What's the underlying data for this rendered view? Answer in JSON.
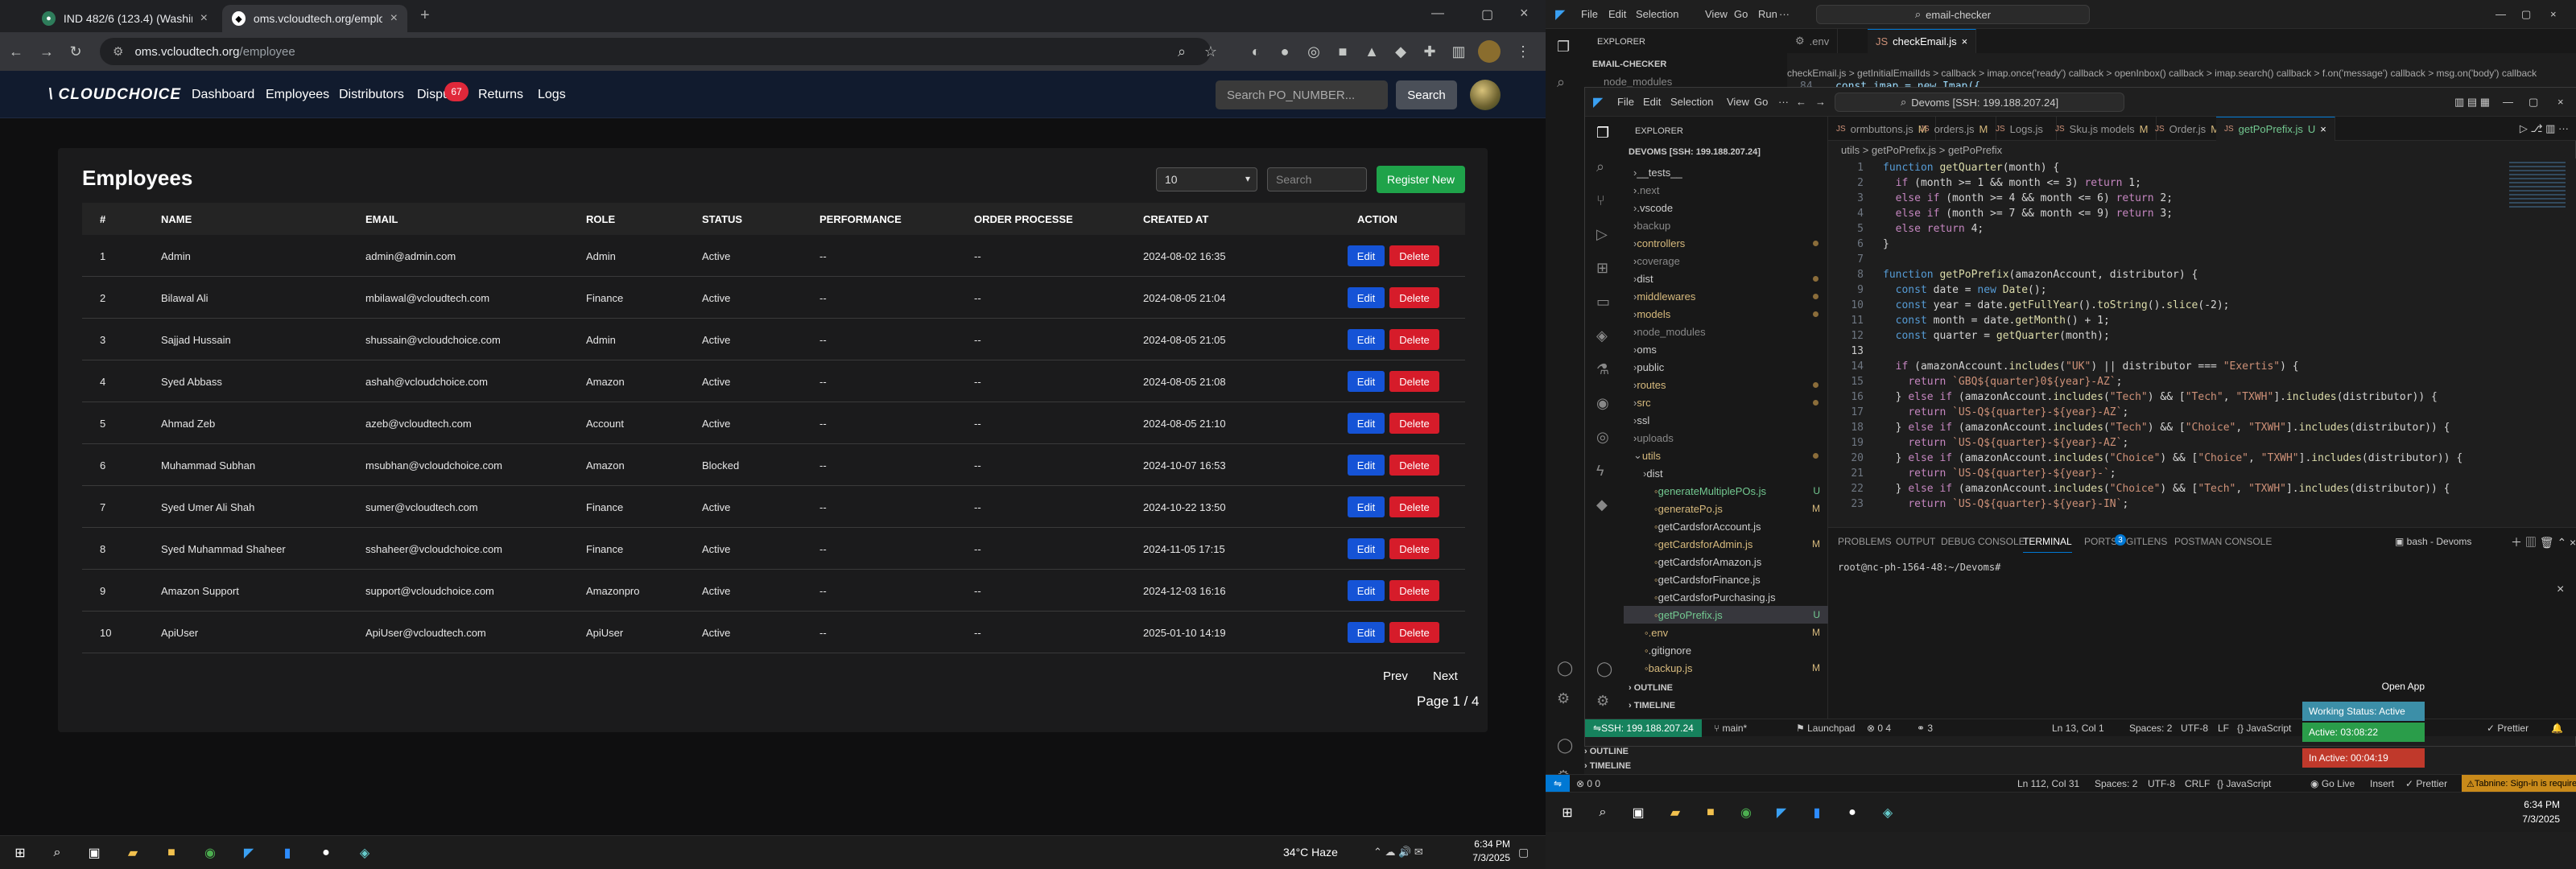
{
  "left_browser": {
    "tabs": [
      {
        "title": "IND 482/6 (123.4) (Washingto",
        "active": false
      },
      {
        "title": "oms.vcloudtech.org/employee",
        "active": true
      }
    ],
    "url_host": "oms.vcloudtech.org",
    "url_path": "/employee"
  },
  "app": {
    "logo": "\\ CLOUDCHOICE",
    "nav": [
      "Dashboard",
      "Employees",
      "Distributors",
      "Dispu",
      "Returns",
      "Logs"
    ],
    "dispute_badge": "67",
    "search_placeholder": "Search PO_NUMBER...",
    "search_button": "Search"
  },
  "employees": {
    "title": "Employees",
    "per_page": "10",
    "search_placeholder": "Search",
    "register_button": "Register New",
    "columns": [
      "#",
      "NAME",
      "EMAIL",
      "ROLE",
      "STATUS",
      "PERFORMANCE",
      "ORDER PROCESSE",
      "CREATED AT",
      "ACTION"
    ],
    "rows": [
      {
        "n": "1",
        "name": "Admin",
        "email": "admin@admin.com",
        "role": "Admin",
        "status": "Active",
        "perf": "--",
        "order": "--",
        "created": "2024-08-02 16:35"
      },
      {
        "n": "2",
        "name": "Bilawal Ali",
        "email": "mbilawal@vcloudtech.com",
        "role": "Finance",
        "status": "Active",
        "perf": "--",
        "order": "--",
        "created": "2024-08-05 21:04"
      },
      {
        "n": "3",
        "name": "Sajjad Hussain",
        "email": "shussain@vcloudchoice.com",
        "role": "Admin",
        "status": "Active",
        "perf": "--",
        "order": "--",
        "created": "2024-08-05 21:05"
      },
      {
        "n": "4",
        "name": "Syed Abbass",
        "email": "ashah@vcloudchoice.com",
        "role": "Amazon",
        "status": "Active",
        "perf": "--",
        "order": "--",
        "created": "2024-08-05 21:08"
      },
      {
        "n": "5",
        "name": "Ahmad Zeb",
        "email": "azeb@vcloudtech.com",
        "role": "Account",
        "status": "Active",
        "perf": "--",
        "order": "--",
        "created": "2024-08-05 21:10"
      },
      {
        "n": "6",
        "name": "Muhammad Subhan",
        "email": "msubhan@vcloudchoice.com",
        "role": "Amazon",
        "status": "Blocked",
        "perf": "--",
        "order": "--",
        "created": "2024-10-07 16:53"
      },
      {
        "n": "7",
        "name": "Syed Umer Ali Shah",
        "email": "sumer@vcloudtech.com",
        "role": "Finance",
        "status": "Active",
        "perf": "--",
        "order": "--",
        "created": "2024-10-22 13:50"
      },
      {
        "n": "8",
        "name": "Syed Muhammad Shaheer",
        "email": "sshaheer@vcloudchoice.com",
        "role": "Finance",
        "status": "Active",
        "perf": "--",
        "order": "--",
        "created": "2024-11-05 17:15"
      },
      {
        "n": "9",
        "name": "Amazon Support",
        "email": "support@vcloudchoice.com",
        "role": "Amazonpro",
        "status": "Active",
        "perf": "--",
        "order": "--",
        "created": "2024-12-03 16:16"
      },
      {
        "n": "10",
        "name": "ApiUser",
        "email": "ApiUser@vcloudtech.com",
        "role": "ApiUser",
        "status": "Active",
        "perf": "--",
        "order": "--",
        "created": "2025-01-10 14:19"
      }
    ],
    "edit_label": "Edit",
    "delete_label": "Delete",
    "prev": "Prev",
    "next": "Next",
    "page_info": "Page 1 / 4"
  },
  "left_taskbar": {
    "weather": "34°C  Haze",
    "time": "6:34 PM",
    "date": "7/3/2025"
  },
  "vscode1": {
    "menus": [
      "File",
      "Edit",
      "Selection",
      "View",
      "Go",
      "Run"
    ],
    "command": "email-checker",
    "explorer": "EXPLORER",
    "folder": "EMAIL-CHECKER",
    "node_modules": "node_modules",
    "tabs": [
      ".env",
      "checkEmail.js"
    ],
    "breadcrumb": "checkEmail.js > getInitialEmailIds > callback > imap.once('ready') callback > openInbox() callback > imap.search() callback > f.on('message') callback > msg.on('body') callback",
    "line_no": "84",
    "line_text": "const imap = new Imap({",
    "outline": "OUTLINE",
    "timeline": "TIMELINE",
    "status": [
      "Ln 112, Col 31",
      "Spaces: 2",
      "UTF-8",
      "CRLF",
      "{} JavaScript",
      "Go Live",
      "Insert",
      "Prettier",
      "Tabnine: Sign-in is required"
    ],
    "errors": "0  0"
  },
  "vscode2": {
    "menus": [
      "File",
      "Edit",
      "Selection",
      "View",
      "Go"
    ],
    "command": "Devoms [SSH: 199.188.207.24]",
    "explorer": "EXPLORER",
    "root": "DEVOMS [SSH: 199.188.207.24]",
    "files": [
      {
        "name": "__tests__",
        "kind": "folder",
        "indent": 1,
        "color": "#ccc"
      },
      {
        "name": ".next",
        "kind": "folder",
        "indent": 1,
        "color": "#888"
      },
      {
        "name": ".vscode",
        "kind": "folder",
        "indent": 1,
        "color": "#ccc"
      },
      {
        "name": "backup",
        "kind": "folder",
        "indent": 1,
        "color": "#888"
      },
      {
        "name": "controllers",
        "kind": "folder",
        "indent": 1,
        "color": "#d7ba7d",
        "dot": true
      },
      {
        "name": "coverage",
        "kind": "folder",
        "indent": 1,
        "color": "#888"
      },
      {
        "name": "dist",
        "kind": "folder",
        "indent": 1,
        "color": "#ccc",
        "dot": true
      },
      {
        "name": "middlewares",
        "kind": "folder",
        "indent": 1,
        "color": "#d7ba7d",
        "dot": true
      },
      {
        "name": "models",
        "kind": "folder",
        "indent": 1,
        "color": "#d7ba7d",
        "dot": true
      },
      {
        "name": "node_modules",
        "kind": "folder",
        "indent": 1,
        "color": "#888"
      },
      {
        "name": "oms",
        "kind": "folder",
        "indent": 1,
        "color": "#ccc"
      },
      {
        "name": "public",
        "kind": "folder",
        "indent": 1,
        "color": "#ccc"
      },
      {
        "name": "routes",
        "kind": "folder",
        "indent": 1,
        "color": "#d7ba7d",
        "dot": true
      },
      {
        "name": "src",
        "kind": "folder",
        "indent": 1,
        "color": "#d7ba7d",
        "dot": true
      },
      {
        "name": "ssl",
        "kind": "folder",
        "indent": 1,
        "color": "#ccc"
      },
      {
        "name": "uploads",
        "kind": "folder",
        "indent": 1,
        "color": "#888"
      },
      {
        "name": "utils",
        "kind": "open",
        "indent": 1,
        "color": "#d7ba7d",
        "dot": true
      },
      {
        "name": "dist",
        "kind": "folder",
        "indent": 2,
        "color": "#ccc"
      },
      {
        "name": "generateMultiplePOs.js",
        "kind": "file",
        "indent": 2,
        "color": "#73c991",
        "st": "U"
      },
      {
        "name": "generatePo.js",
        "kind": "file",
        "indent": 2,
        "color": "#d7ba7d",
        "st": "M"
      },
      {
        "name": "getCardsforAccount.js",
        "kind": "file",
        "indent": 2,
        "color": "#ccc"
      },
      {
        "name": "getCardsforAdmin.js",
        "kind": "file",
        "indent": 2,
        "color": "#d7ba7d",
        "st": "M"
      },
      {
        "name": "getCardsforAmazon.js",
        "kind": "file",
        "indent": 2,
        "color": "#ccc"
      },
      {
        "name": "getCardsforFinance.js",
        "kind": "file",
        "indent": 2,
        "color": "#ccc"
      },
      {
        "name": "getCardsforPurchasing.js",
        "kind": "file",
        "indent": 2,
        "color": "#ccc"
      },
      {
        "name": "getPoPrefix.js",
        "kind": "file",
        "indent": 2,
        "color": "#73c991",
        "st": "U",
        "selected": true
      },
      {
        "name": ".env",
        "kind": "file",
        "indent": 1,
        "color": "#d7ba7d",
        "st": "M"
      },
      {
        "name": ".gitignore",
        "kind": "file",
        "indent": 1,
        "color": "#ccc"
      },
      {
        "name": "backup.js",
        "kind": "file",
        "indent": 1,
        "color": "#d7ba7d",
        "st": "M"
      }
    ],
    "outline": "OUTLINE",
    "timeline": "TIMELINE",
    "tabs": [
      {
        "label": "ormbuttons.js",
        "st": "M"
      },
      {
        "label": "orders.js",
        "st": "M"
      },
      {
        "label": "Logs.js",
        "st": ""
      },
      {
        "label": "Sku.js models",
        "st": "M"
      },
      {
        "label": "Order.js",
        "st": "M"
      },
      {
        "label": "getPoPrefix.js",
        "st": "U",
        "active": true
      }
    ],
    "breadcrumb": "utils > getPoPrefix.js > getPoPrefix",
    "code": [
      "function getQuarter(month) {",
      "  if (month >= 1 && month <= 3) return 1;",
      "  else if (month >= 4 && month <= 6) return 2;",
      "  else if (month >= 7 && month <= 9) return 3;",
      "  else return 4;",
      "}",
      "",
      "function getPoPrefix(amazonAccount, distributor) {",
      "  const date = new Date();",
      "  const year = date.getFullYear().toString().slice(-2);",
      "  const month = date.getMonth() + 1;",
      "  const quarter = getQuarter(month);",
      "",
      "  if (amazonAccount.includes(\"UK\") || distributor === \"Exertis\") {",
      "    return `GBQ${quarter}0${year}-AZ`;",
      "  } else if (amazonAccount.includes(\"Tech\") && [\"Tech\", \"TXWH\"].includes(distributor)) {",
      "    return `US-Q${quarter}-${year}-AZ`;",
      "  } else if (amazonAccount.includes(\"Tech\") && [\"Choice\", \"TXWH\"].includes(distributor)) {",
      "    return `US-Q${quarter}-${year}-AZ`;",
      "  } else if (amazonAccount.includes(\"Choice\") && [\"Choice\", \"TXWH\"].includes(distributor)) {",
      "    return `US-Q${quarter}-${year}-`;",
      "  } else if (amazonAccount.includes(\"Choice\") && [\"Tech\", \"TXWH\"].includes(distributor)) {",
      "    return `US-Q${quarter}-${year}-IN`;"
    ],
    "panel_tabs": [
      "PROBLEMS",
      "OUTPUT",
      "DEBUG CONSOLE",
      "TERMINAL",
      "PORTS",
      "GITLENS",
      "POSTMAN CONSOLE"
    ],
    "ports_count": "3",
    "shell": "bash - Devoms",
    "prompt": "root@nc-ph-1564-48:~/Devoms#",
    "status": [
      "SSH: 199.188.207.24",
      "main*",
      "Launchpad",
      "0  4",
      "3",
      "Ln 13, Col 1",
      "Spaces: 2",
      "UTF-8",
      "LF",
      "{} JavaScript",
      "Prettier"
    ]
  },
  "tracker": {
    "open_app": "Open App",
    "working": "Working Status: Active",
    "active": "Active: 03:08:22",
    "inactive": "In Active: 00:04:19"
  },
  "right_taskbar": {
    "time": "6:34 PM",
    "date": "7/3/2025"
  }
}
